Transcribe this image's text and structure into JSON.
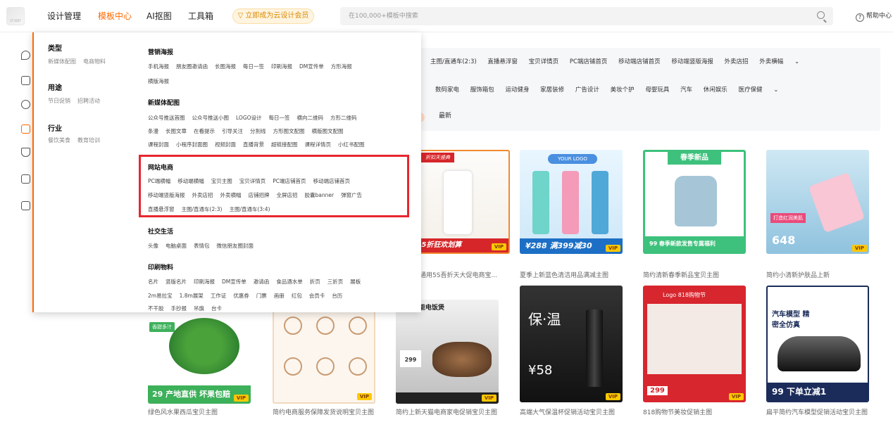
{
  "header": {
    "logo_text": "ST EDIT",
    "nav": [
      "设计管理",
      "模板中心",
      "AI抠图",
      "工具箱"
    ],
    "vip_label": "▽ 立即成为云设计会员",
    "search_placeholder": "在100,000+模板中搜索",
    "help_label": "帮助中心"
  },
  "filters": {
    "row1": [
      "主图/直通车(2:3)",
      "直播悬浮窗",
      "宝贝详情页",
      "PC端店铺首页",
      "移动端店铺首页",
      "移动端竖版海报",
      "外卖店招",
      "外卖横幅"
    ],
    "row2": [
      "数码家电",
      "服饰箱包",
      "运动健身",
      "家居装修",
      "广告设计",
      "美妆个护",
      "母婴玩具",
      "汽车",
      "休闲娱乐",
      "医疗保健"
    ],
    "sort_newest": "最新"
  },
  "menu": {
    "left": [
      {
        "title": "类型",
        "items": [
          "新媒体配图",
          "电商物料"
        ]
      },
      {
        "title": "用途",
        "items": [
          "节日促销",
          "招聘活动"
        ]
      },
      {
        "title": "行业",
        "items": [
          "餐饮美食",
          "教育培训"
        ]
      }
    ],
    "sections": [
      {
        "title": "营销海报",
        "lines": [
          [
            "手机海报",
            "朋友圈邀请函",
            "长图海报",
            "每日一签",
            "印刷海报",
            "DM宣传单",
            "方形海报"
          ],
          [
            "横版海报"
          ]
        ]
      },
      {
        "title": "新媒体配图",
        "lines": [
          [
            "公众号推送首图",
            "公众号推送小图",
            "LOGO设计",
            "每日一签",
            "横向二维码",
            "方形二维码"
          ],
          [
            "条漫",
            "长图文章",
            "在看提示",
            "引导关注",
            "分割线",
            "方形图文配图",
            "横版图文配图"
          ],
          [
            "课程封面",
            "小程序封面图",
            "视频封面",
            "直播背景",
            "超链接配图",
            "课程详情页",
            "小红书配图"
          ]
        ]
      },
      {
        "title": "网站电商",
        "lines": [
          [
            "PC端横幅",
            "移动端横幅",
            "宝贝主图",
            "宝贝详情页",
            "PC端店铺首页",
            "移动端店铺首页"
          ],
          [
            "移动端竖版海报",
            "外卖店招",
            "外卖横幅",
            "店铺招牌",
            "全屏店招",
            "胶囊banner",
            "弹窗广告"
          ],
          [
            "直播悬浮窗",
            "主图/直通车(2:3)",
            "主图/直通车(3:4)"
          ]
        ]
      },
      {
        "title": "社交生活",
        "lines": [
          [
            "头像",
            "电脑桌面",
            "表情包",
            "微信朋友圈封面"
          ]
        ]
      },
      {
        "title": "印刷物料",
        "lines": [
          [
            "名片",
            "竖版名片",
            "印刷海报",
            "DM宣传单",
            "邀请函",
            "食品酒水单",
            "折页",
            "三折页",
            "展板"
          ],
          [
            "2m易拉宝",
            "1.8m展架",
            "工作证",
            "优惠券",
            "门票",
            "画册",
            "红包",
            "会员卡",
            "台历"
          ],
          [
            "不干胶",
            "手抄报",
            "吊旗",
            "台卡"
          ]
        ]
      }
    ]
  },
  "cards": [
    {
      "banner": "折扣天盛典",
      "big": "8 5折狂欢划算",
      "caption": "通用5S吾折天大促电商宝..."
    },
    {
      "banner": "YOUR LOGO",
      "big": "¥288 满399减30",
      "caption": "夏季上新蓝色清洁用品满减主图"
    },
    {
      "banner": "春季新品",
      "big": "99 春季新款发售专属福利",
      "caption": "简约清新春季新品宝贝主图"
    },
    {
      "banner": "",
      "big": "648",
      "caption": "简约小清新护肤品上新"
    },
    {
      "banner": "香甜多汁",
      "big": "29 产地直供 坏果包赔",
      "caption": "绿色风水果西瓜宝贝主图"
    },
    {
      "banner": "",
      "big": "",
      "caption": "简约电商服务保障发货说明宝贝主图"
    },
    {
      "banner": "智能电饭煲",
      "big": "299",
      "caption": "简约上新天猫电商家电促销宝贝主图"
    },
    {
      "banner": "保·温",
      "big": "¥58",
      "caption": "高端大气保温杯促销活动宝贝主图"
    },
    {
      "banner": "Logo 818购物节",
      "big": "299",
      "caption": "818购物节美妆促销主图"
    },
    {
      "banner": "汽车模型 精密全仿真",
      "big": "99 下单立减1",
      "caption": "扁平简约汽车模型促销活动宝贝主图"
    }
  ],
  "vip_tag": "VIP"
}
